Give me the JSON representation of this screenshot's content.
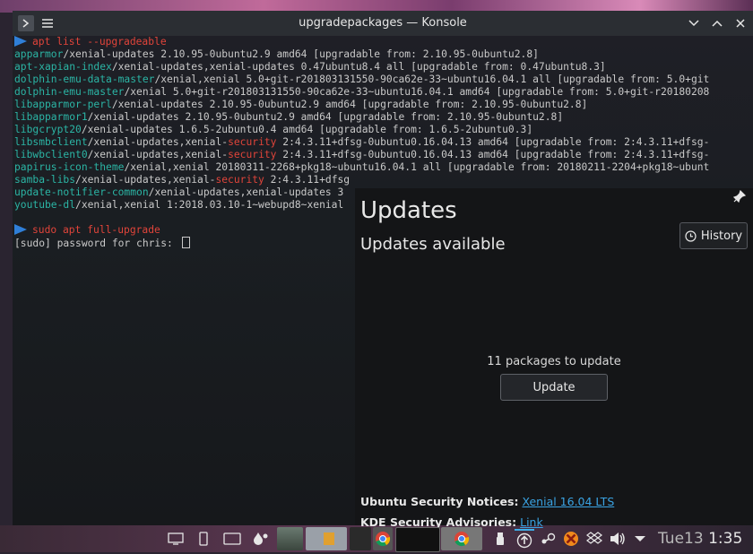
{
  "window": {
    "title": "upgradepackages — Konsole"
  },
  "terminal": {
    "lines": [
      {
        "type": "prompt",
        "cmd": "apt list --upgradeable"
      },
      {
        "pkg": "apparmor",
        "rest": "/xenial-updates 2.10.95-0ubuntu2.9 amd64 [upgradable from: 2.10.95-0ubuntu2.8]"
      },
      {
        "pkg": "apt-xapian-index",
        "rest": "/xenial-updates,xenial-updates 0.47ubuntu8.4 all [upgradable from: 0.47ubuntu8.3]"
      },
      {
        "pkg": "dolphin-emu-data-master",
        "rest": "/xenial,xenial 5.0+git-r201803131550-90ca62e-33~ubuntu16.04.1 all [upgradable from: 5.0+git"
      },
      {
        "pkg": "dolphin-emu-master",
        "rest": "/xenial 5.0+git-r201803131550-90ca62e-33~ubuntu16.04.1 amd64 [upgradable from: 5.0+git-r20180208"
      },
      {
        "pkg": "libapparmor-perl",
        "rest": "/xenial-updates 2.10.95-0ubuntu2.9 amd64 [upgradable from: 2.10.95-0ubuntu2.8]"
      },
      {
        "pkg": "libapparmor1",
        "rest": "/xenial-updates 2.10.95-0ubuntu2.9 amd64 [upgradable from: 2.10.95-0ubuntu2.8]"
      },
      {
        "pkg": "libgcrypt20",
        "rest": "/xenial-updates 1.6.5-2ubuntu0.4 amd64 [upgradable from: 1.6.5-2ubuntu0.3]"
      },
      {
        "pkg": "libsmbclient",
        "rest": "/xenial-updates,xenial-",
        "sec": "security",
        "rest2": " 2:4.3.11+dfsg-0ubuntu0.16.04.13 amd64 [upgradable from: 2:4.3.11+dfsg-"
      },
      {
        "pkg": "libwbclient0",
        "rest": "/xenial-updates,xenial-",
        "sec": "security",
        "rest2": " 2:4.3.11+dfsg-0ubuntu0.16.04.13 amd64 [upgradable from: 2:4.3.11+dfsg-"
      },
      {
        "pkg": "papirus-icon-theme",
        "rest": "/xenial,xenial 20180311-2268+pkg18~ubuntu16.04.1 all [upgradable from: 20180211-2204+pkg18~ubunt"
      },
      {
        "pkg": "samba-libs",
        "rest": "/xenial-updates,xenial-",
        "sec": "security",
        "rest2": " 2:4.3.11+dfsg"
      },
      {
        "pkg": "update-notifier-common",
        "rest": "/xenial-updates,xenial-updates 3"
      },
      {
        "pkg": "youtube-dl",
        "rest": "/xenial,xenial 1:2018.03.10-1~webupd8~xenial"
      },
      {
        "type": "blank"
      },
      {
        "type": "prompt",
        "cmd": "sudo apt full-upgrade"
      },
      {
        "type": "plain",
        "text": "[sudo] password for chris: "
      }
    ]
  },
  "updates": {
    "title": "Updates",
    "subtitle": "Updates available",
    "history_label": "History",
    "count_text": "11 packages to update",
    "update_label": "Update",
    "ubuntu_label": "Ubuntu Security Notices:",
    "ubuntu_link": "Xenial 16.04 LTS",
    "kde_label": "KDE Security Advisories:",
    "kde_link": "Link"
  },
  "taskbar": {
    "day": "Tue13",
    "time": "1:35"
  },
  "colors": {
    "accent_link": "#3aa3e3",
    "pkg": "#2bb5a5",
    "security": "#e0443a"
  }
}
